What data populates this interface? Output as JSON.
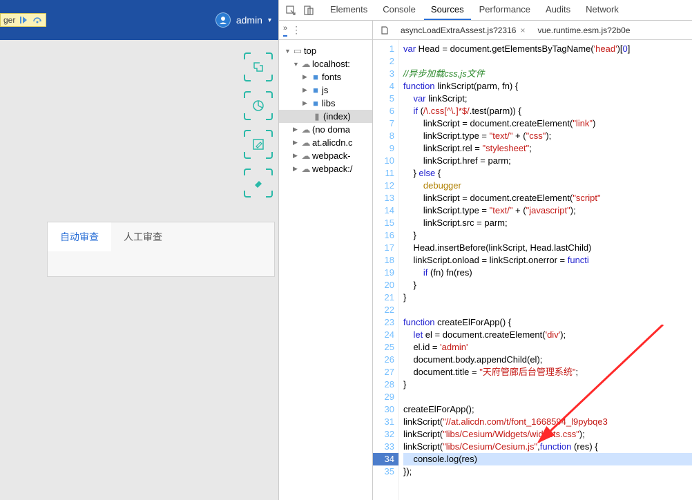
{
  "header": {
    "debugger_label": "ger",
    "admin_name": "admin"
  },
  "review": {
    "tab_auto": "自动审查",
    "tab_manual": "人工审查"
  },
  "devtools": {
    "tabs": [
      "Elements",
      "Console",
      "Sources",
      "Performance",
      "Audits",
      "Network"
    ],
    "active_tab": "Sources",
    "open_files": [
      {
        "name": "asyncLoadExtraAssest.js?2316"
      },
      {
        "name": "vue.runtime.esm.js?2b0e"
      }
    ]
  },
  "file_nav": {
    "top": "top",
    "localhost": "localhost:",
    "fonts": "fonts",
    "js": "js",
    "libs": "libs",
    "index": "(index)",
    "no_domain": "(no doma",
    "alicdn": "at.alicdn.c",
    "webpack1": "webpack-",
    "webpack2": "webpack:/"
  },
  "code": {
    "lines": [
      {
        "n": 1,
        "html": "<span class='kw'>var</span> Head = document.getElementsByTagName(<span class='str'>'head'</span>)[<span class='num'>0</span>]"
      },
      {
        "n": 2,
        "html": ""
      },
      {
        "n": 3,
        "html": "<span class='com'>//异步加载css,js文件</span>"
      },
      {
        "n": 4,
        "html": "<span class='kw'>function</span> <span class='fn'>linkScript</span>(parm, fn) {"
      },
      {
        "n": 5,
        "html": "    <span class='kw'>var</span> linkScript;"
      },
      {
        "n": 6,
        "html": "    <span class='kw'>if</span> (<span class='str'>/\\.css[^\\.]*$/</span>.test(parm)) {"
      },
      {
        "n": 7,
        "html": "        linkScript = document.createElement(<span class='str'>\"link\"</span>)"
      },
      {
        "n": 8,
        "html": "        linkScript.type = <span class='str'>\"text/\"</span> + (<span class='str'>\"css\"</span>);"
      },
      {
        "n": 9,
        "html": "        linkScript.rel = <span class='str'>\"stylesheet\"</span>;"
      },
      {
        "n": 10,
        "html": "        linkScript.href = parm;"
      },
      {
        "n": 11,
        "html": "    } <span class='kw'>else</span> {"
      },
      {
        "n": 12,
        "html": "        <span class='dbg'>debugger</span>"
      },
      {
        "n": 13,
        "html": "        linkScript = document.createElement(<span class='str'>\"script\"</span>"
      },
      {
        "n": 14,
        "html": "        linkScript.type = <span class='str'>\"text/\"</span> + (<span class='str'>\"javascript\"</span>);"
      },
      {
        "n": 15,
        "html": "        linkScript.src = parm;"
      },
      {
        "n": 16,
        "html": "    }"
      },
      {
        "n": 17,
        "html": "    Head.insertBefore(linkScript, Head.lastChild)"
      },
      {
        "n": 18,
        "html": "    linkScript.onload = linkScript.onerror = <span class='kw'>functi</span>"
      },
      {
        "n": 19,
        "html": "        <span class='kw'>if</span> (fn) fn(res)"
      },
      {
        "n": 20,
        "html": "    }"
      },
      {
        "n": 21,
        "html": "}"
      },
      {
        "n": 22,
        "html": ""
      },
      {
        "n": 23,
        "html": "<span class='kw'>function</span> <span class='fn'>createElForApp</span>() {"
      },
      {
        "n": 24,
        "html": "    <span class='kw'>let</span> el = document.createElement(<span class='str'>'div'</span>);"
      },
      {
        "n": 25,
        "html": "    el.id = <span class='str'>'admin'</span>"
      },
      {
        "n": 26,
        "html": "    document.body.appendChild(el);"
      },
      {
        "n": 27,
        "html": "    document.title = <span class='str'>\"天府管廊后台管理系统\"</span>;"
      },
      {
        "n": 28,
        "html": "}"
      },
      {
        "n": 29,
        "html": ""
      },
      {
        "n": 30,
        "html": "createElForApp();"
      },
      {
        "n": 31,
        "html": "linkScript(<span class='str'>\"//at.alicdn.com/t/font_1668594_l9pybqe3</span>"
      },
      {
        "n": 32,
        "html": "linkScript(<span class='str'>\"libs/Cesium/Widgets/widgets.css\"</span>);"
      },
      {
        "n": 33,
        "html": "linkScript(<span class='str'>\"libs/Cesium/Cesium.js\"</span>,<span class='kw'>function</span> (res) {"
      },
      {
        "n": 34,
        "html": "    console.log(res)",
        "hl": true
      },
      {
        "n": 35,
        "html": "});"
      }
    ]
  }
}
